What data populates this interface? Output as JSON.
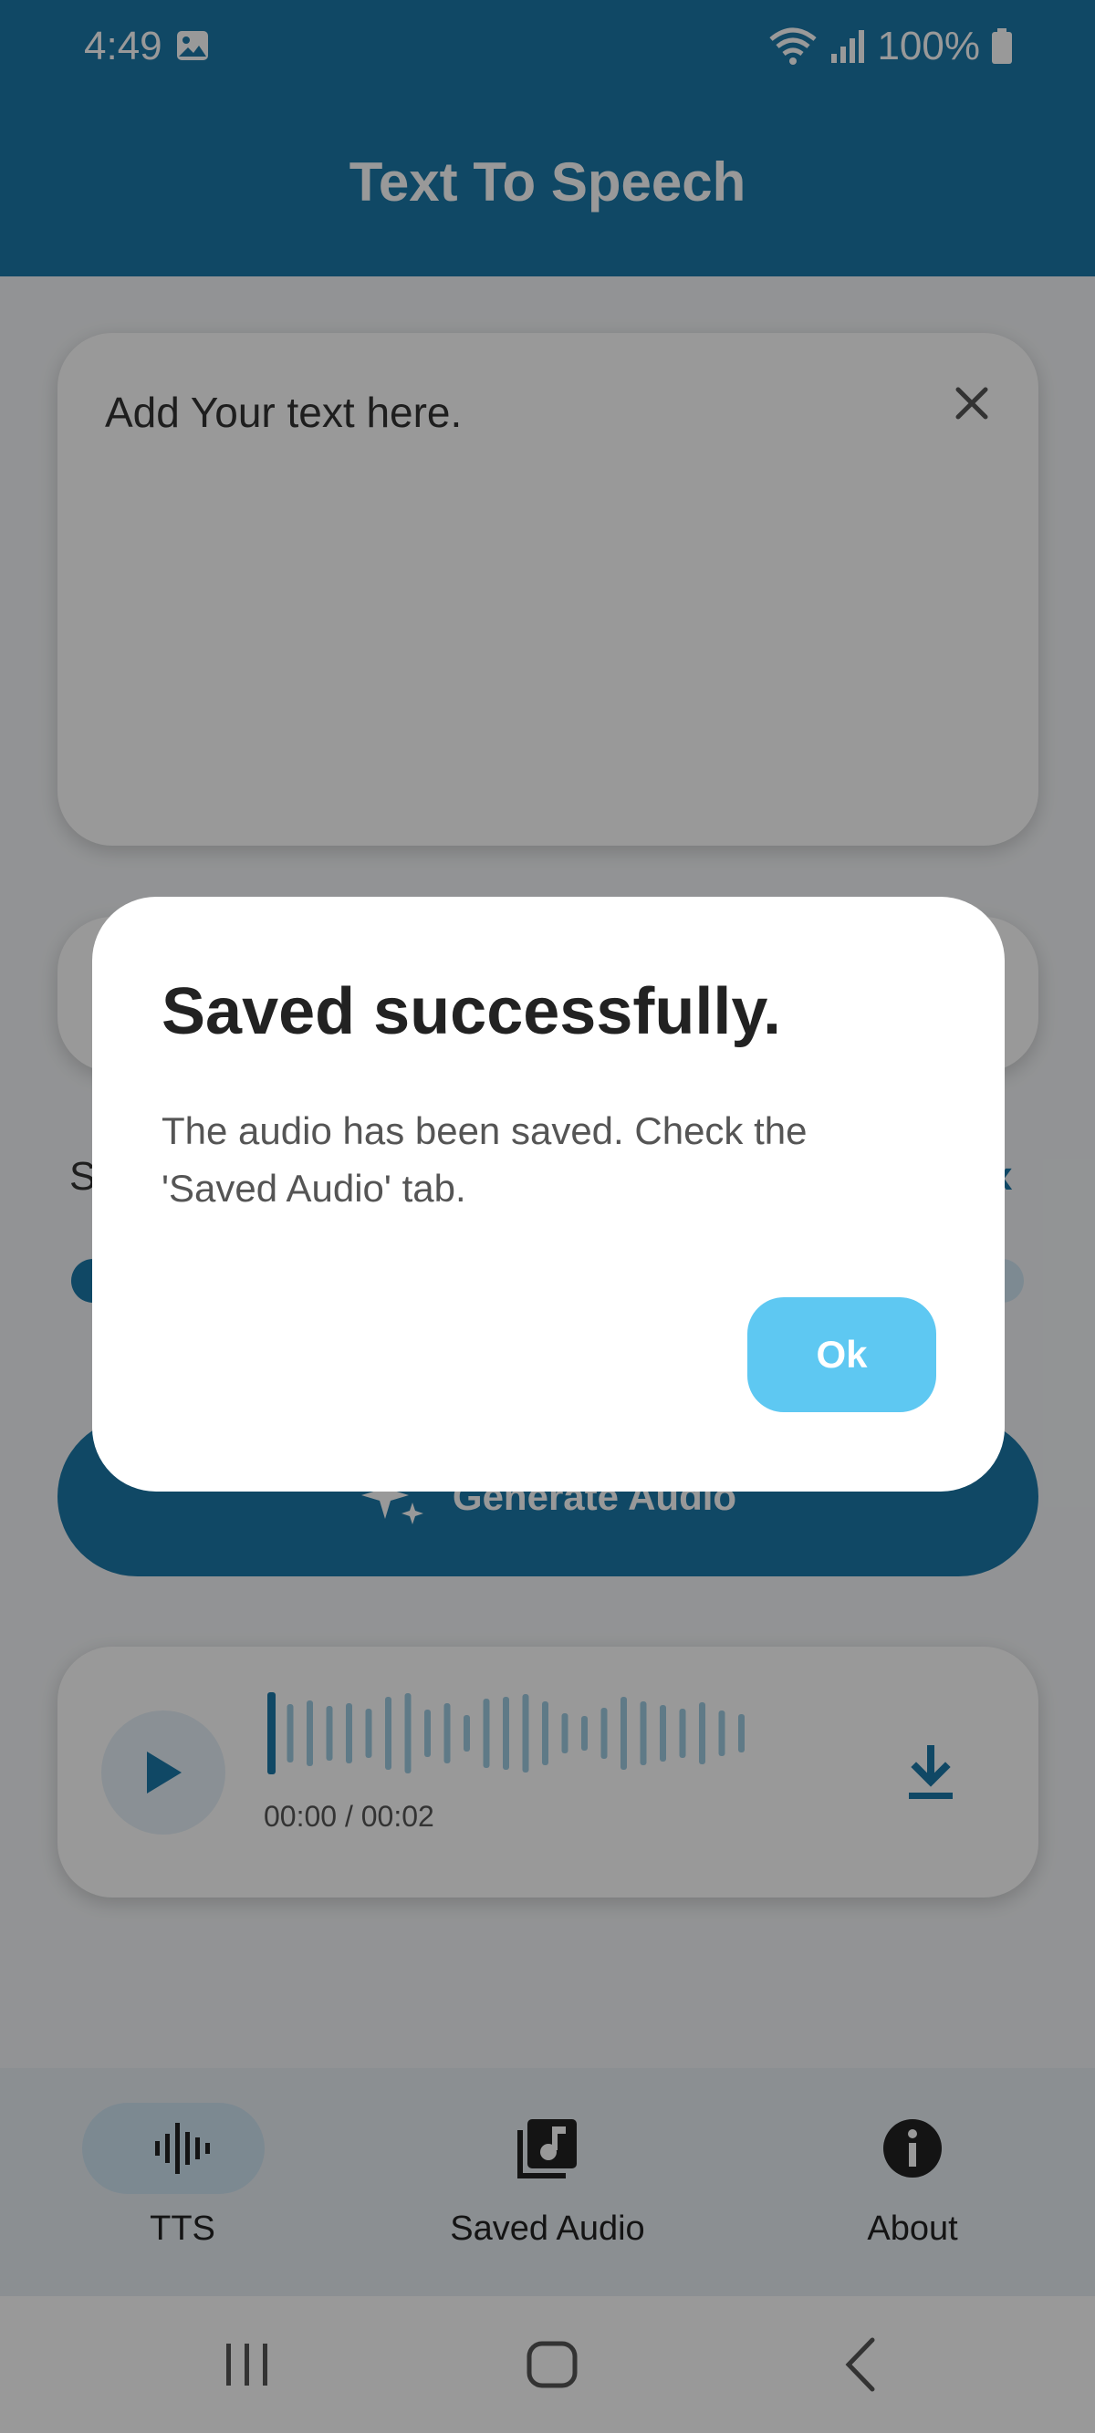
{
  "status_bar": {
    "time": "4:49",
    "battery": "100%"
  },
  "app_bar": {
    "title": "Text To Speech"
  },
  "text_input": {
    "placeholder": "Add Your text here."
  },
  "speed": {
    "label_visible": "S",
    "max_label_visible": "x",
    "value_fraction": 0.0
  },
  "generate": {
    "label": "Generate Audio"
  },
  "player": {
    "time": "00:00 / 00:02",
    "progress_fraction": 0.0
  },
  "bottom_nav": {
    "items": [
      {
        "label": "TTS",
        "icon": "waveform-icon",
        "active": true
      },
      {
        "label": "Saved Audio",
        "icon": "music-library-icon",
        "active": false
      },
      {
        "label": "About",
        "icon": "info-icon",
        "active": false
      }
    ]
  },
  "dialog": {
    "title": "Saved successfully.",
    "message": "The audio has been saved. Check the 'Saved Audio' tab.",
    "ok_label": "Ok"
  },
  "colors": {
    "primary": "#1b78a8",
    "dialog_button": "#5ec8f2",
    "scrim": "rgba(0,0,0,0.40)"
  }
}
